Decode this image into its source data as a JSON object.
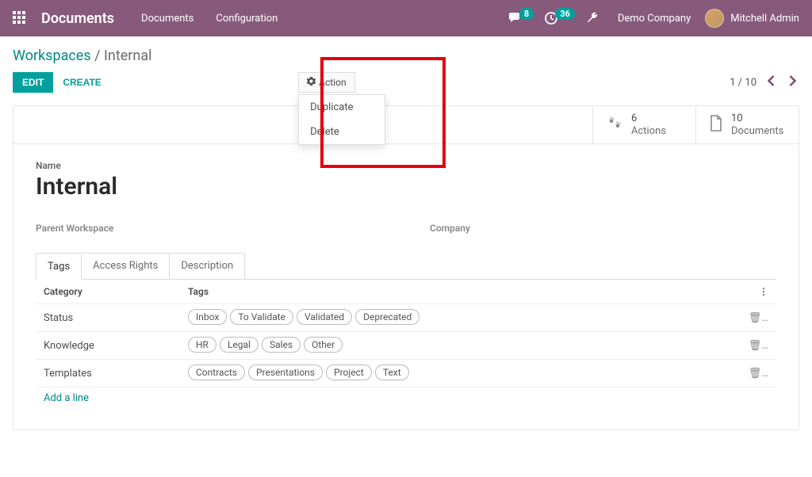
{
  "topbar": {
    "brand": "Documents",
    "nav": {
      "documents": "Documents",
      "configuration": "Configuration"
    },
    "messages_badge": "8",
    "activities_badge": "36",
    "company": "Demo Company",
    "user": "Mitchell Admin"
  },
  "breadcrumbs": {
    "root": "Workspaces",
    "sep": " / ",
    "current": "Internal"
  },
  "buttons": {
    "edit": "EDIT",
    "create": "CREATE"
  },
  "action_menu": {
    "label": "Action",
    "duplicate": "Duplicate",
    "delete": "Delete"
  },
  "pager": {
    "range": "1 / 10"
  },
  "stats": {
    "actions_count": "6",
    "actions_label": "Actions",
    "documents_count": "10",
    "documents_label": "Documents"
  },
  "form": {
    "name_label": "Name",
    "name_value": "Internal",
    "parent_label": "Parent Workspace",
    "company_label": "Company"
  },
  "tabs": {
    "tags": "Tags",
    "access": "Access Rights",
    "desc": "Description"
  },
  "grid": {
    "head_category": "Category",
    "head_tags": "Tags",
    "rows": [
      {
        "cat": "Status",
        "tags": [
          "Inbox",
          "To Validate",
          "Validated",
          "Deprecated"
        ]
      },
      {
        "cat": "Knowledge",
        "tags": [
          "HR",
          "Legal",
          "Sales",
          "Other"
        ]
      },
      {
        "cat": "Templates",
        "tags": [
          "Contracts",
          "Presentations",
          "Project",
          "Text"
        ]
      }
    ],
    "add_line": "Add a line"
  }
}
